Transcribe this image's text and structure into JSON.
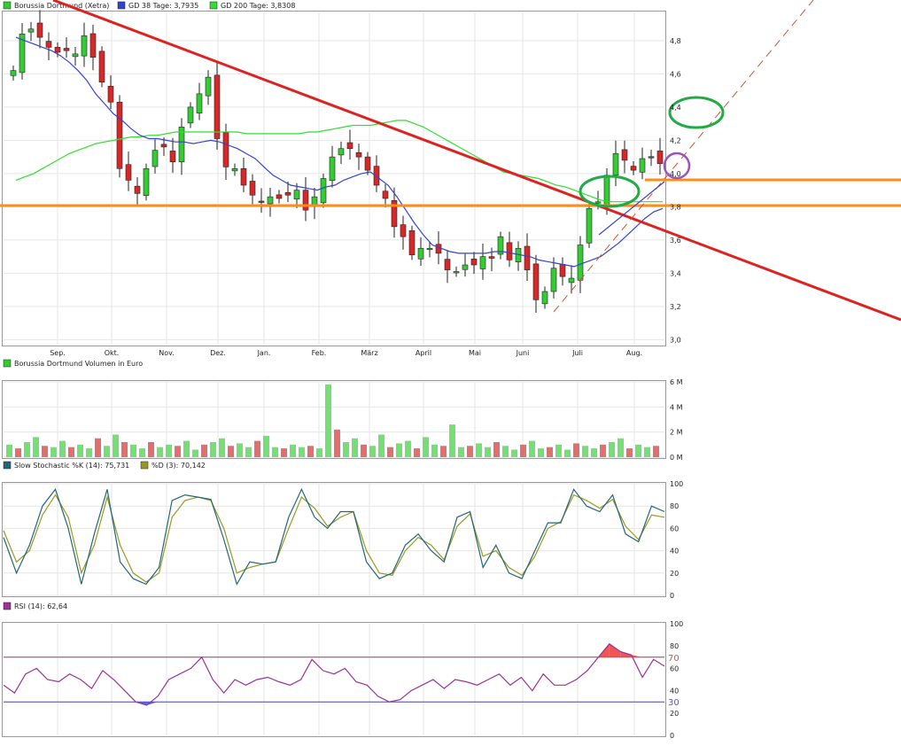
{
  "colors": {
    "up": "#33cc33",
    "down": "#d62828",
    "candle_outline": "#222222",
    "gd38": "#3344cc",
    "gd200": "#33dd33",
    "trend": "#dd2222",
    "support": "#ff8c1a",
    "circle_green": "#22aa44",
    "circle_purple": "#9955bb",
    "stoch_k": "#226677",
    "stoch_d": "#999922",
    "rsi": "#993399",
    "grid": "#e6e6e6"
  },
  "legends": {
    "price": "Borussia Dortmund (Xetra)",
    "gd38": "GD 38 Tage: 3,7935",
    "gd200": "GD 200 Tage: 3,8308",
    "volume": "Borussia Dortmund Volumen in Euro",
    "stoch_k": "Slow Stochastic %K (14): 75,731",
    "stoch_d": "%D (3): 70,142",
    "rsi": "RSI (14): 62,64"
  },
  "chart_data": [
    {
      "type": "candlestick",
      "title": "Borussia Dortmund (Xetra)",
      "x_ticks": [
        "Sep.",
        "Okt.",
        "Nov.",
        "Dez.",
        "Jan.",
        "Feb.",
        "März",
        "April",
        "Mai",
        "Juni",
        "Juli",
        "Aug."
      ],
      "y_ticks": [
        "3,0",
        "3,2",
        "3,4",
        "3,6",
        "3,8",
        "4,0",
        "4,2",
        "4,4",
        "4,6",
        "4,8"
      ],
      "ylim": [
        2.97,
        4.97
      ],
      "series_close": [
        4.62,
        4.84,
        4.87,
        4.82,
        4.76,
        4.73,
        4.74,
        4.72,
        4.83,
        4.7,
        4.55,
        4.43,
        4.03,
        3.96,
        3.88,
        4.03,
        4.14,
        4.16,
        4.07,
        4.28,
        4.4,
        4.48,
        4.58,
        4.21,
        4.04,
        4.03,
        3.93,
        3.87,
        3.83,
        3.86,
        3.85,
        3.87,
        3.9,
        3.78,
        3.86,
        3.97,
        4.1,
        4.15,
        4.15,
        4.1,
        4.02,
        3.93,
        3.85,
        3.68,
        3.62,
        3.51,
        3.55,
        3.55,
        3.52,
        3.42,
        3.41,
        3.45,
        3.45,
        3.5,
        3.49,
        3.62,
        3.48,
        3.55,
        3.42,
        3.24,
        3.29,
        3.43,
        3.38,
        3.37,
        3.57,
        3.79,
        3.83,
        3.99,
        4.12,
        4.08,
        4.02,
        4.09,
        4.1,
        4.06
      ],
      "gd38": [
        4.82,
        4.8,
        4.78,
        4.76,
        4.74,
        4.71,
        4.67,
        4.62,
        4.56,
        4.48,
        4.42,
        4.36,
        4.32,
        4.27,
        4.23,
        4.21,
        4.21,
        4.2,
        4.19,
        4.19,
        4.18,
        4.19,
        4.2,
        4.19,
        4.17,
        4.15,
        4.12,
        4.09,
        4.04,
        3.99,
        3.96,
        3.93,
        3.92,
        3.91,
        3.9,
        3.92,
        3.93,
        3.96,
        3.98,
        4.0,
        4.01,
        3.97,
        3.93,
        3.86,
        3.78,
        3.7,
        3.63,
        3.57,
        3.55,
        3.53,
        3.52,
        3.52,
        3.52,
        3.52,
        3.53,
        3.53,
        3.52,
        3.51,
        3.5,
        3.48,
        3.47,
        3.46,
        3.45,
        3.44,
        3.46,
        3.48,
        3.5,
        3.54,
        3.58,
        3.63,
        3.68,
        3.73,
        3.77,
        3.79
      ],
      "gd200": [
        3.96,
        3.98,
        4.0,
        4.03,
        4.06,
        4.09,
        4.12,
        4.14,
        4.16,
        4.18,
        4.19,
        4.2,
        4.21,
        4.22,
        4.22,
        4.23,
        4.23,
        4.24,
        4.25,
        4.25,
        4.25,
        4.25,
        4.25,
        4.25,
        4.25,
        4.25,
        4.24,
        4.24,
        4.24,
        4.24,
        4.24,
        4.24,
        4.24,
        4.25,
        4.25,
        4.26,
        4.27,
        4.28,
        4.29,
        4.29,
        4.29,
        4.3,
        4.31,
        4.32,
        4.32,
        4.3,
        4.28,
        4.25,
        4.22,
        4.19,
        4.16,
        4.13,
        4.1,
        4.07,
        4.04,
        4.01,
        4.0,
        3.99,
        3.98,
        3.97,
        3.95,
        3.93,
        3.92,
        3.9,
        3.88,
        3.86,
        3.84,
        3.83,
        3.83,
        3.83,
        3.83,
        3.83,
        3.83,
        3.83
      ]
    },
    {
      "type": "bar",
      "title": "Borussia Dortmund Volumen in Euro",
      "y_ticks": [
        "0 M",
        "2 M",
        "4 M",
        "6 M"
      ],
      "ylim": [
        0,
        6
      ],
      "values": [
        1.0,
        0.7,
        1.2,
        1.6,
        0.9,
        0.8,
        1.3,
        0.8,
        1.0,
        0.7,
        1.5,
        0.9,
        1.8,
        1.2,
        1.0,
        0.7,
        1.2,
        0.8,
        1.0,
        0.9,
        1.3,
        0.6,
        1.0,
        1.2,
        1.5,
        0.9,
        1.1,
        0.8,
        1.3,
        1.7,
        0.8,
        0.7,
        1.0,
        0.8,
        0.9,
        0.7,
        5.8,
        2.2,
        1.2,
        1.5,
        1.0,
        0.9,
        1.8,
        0.8,
        1.1,
        1.3,
        0.7,
        1.6,
        1.0,
        0.9,
        2.6,
        0.8,
        0.9,
        1.1,
        0.8,
        1.2,
        0.9,
        0.6,
        1.0,
        1.3,
        0.7,
        0.8,
        1.0,
        0.6,
        1.1,
        0.9,
        0.7,
        1.0,
        1.2,
        1.5,
        0.7,
        1.0,
        0.8,
        0.9
      ]
    },
    {
      "type": "line",
      "title": "Slow Stochastic",
      "y_ticks": [
        "0",
        "20",
        "40",
        "60",
        "80",
        "100"
      ],
      "ylim": [
        0,
        100
      ],
      "series": [
        {
          "name": "Slow Stochastic %K (14): 75,731",
          "values": [
            52,
            20,
            45,
            80,
            95,
            60,
            10,
            55,
            95,
            30,
            15,
            10,
            25,
            85,
            90,
            88,
            86,
            50,
            10,
            30,
            28,
            30,
            70,
            95,
            70,
            60,
            75,
            75,
            30,
            15,
            20,
            45,
            55,
            40,
            30,
            70,
            75,
            25,
            45,
            20,
            15,
            40,
            65,
            65,
            95,
            80,
            75,
            90,
            55,
            48,
            80,
            75
          ]
        },
        {
          "name": "%D (3): 70,142",
          "values": [
            58,
            30,
            40,
            72,
            90,
            70,
            20,
            45,
            88,
            45,
            20,
            12,
            20,
            70,
            85,
            88,
            85,
            60,
            20,
            25,
            28,
            30,
            60,
            88,
            78,
            62,
            70,
            75,
            40,
            20,
            18,
            40,
            52,
            45,
            32,
            62,
            73,
            35,
            40,
            25,
            18,
            35,
            60,
            66,
            90,
            85,
            78,
            86,
            62,
            50,
            72,
            70
          ]
        }
      ]
    },
    {
      "type": "line",
      "title": "RSI (14): 62,64",
      "y_ticks": [
        "0",
        "20",
        "40",
        "60",
        "80",
        "100"
      ],
      "ylim": [
        0,
        100
      ],
      "reference_lines": [
        {
          "value": 70,
          "label": "70"
        },
        {
          "value": 30,
          "label": "30"
        }
      ],
      "series": [
        {
          "name": "RSI (14): 62,64",
          "values": [
            45,
            38,
            55,
            60,
            50,
            48,
            55,
            50,
            42,
            58,
            50,
            40,
            30,
            27,
            35,
            50,
            55,
            60,
            70,
            50,
            38,
            50,
            45,
            50,
            52,
            48,
            45,
            50,
            68,
            58,
            55,
            60,
            48,
            45,
            35,
            30,
            32,
            40,
            45,
            50,
            42,
            50,
            48,
            45,
            50,
            55,
            45,
            52,
            40,
            55,
            45,
            45,
            50,
            58,
            70,
            82,
            75,
            72,
            52,
            68,
            62
          ]
        }
      ]
    }
  ]
}
